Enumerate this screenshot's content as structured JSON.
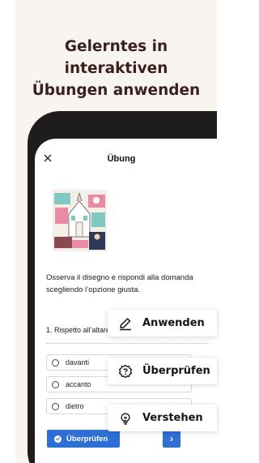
{
  "headline": {
    "line1": "Gelerntes in interaktiven",
    "line2": "Übungen anwenden"
  },
  "screen": {
    "title": "Übung",
    "prompt": "Osserva il disegno e rispondi alla domanda scegliendo l’opzione giusta.",
    "question": "1. Rispetto all’altare",
    "options": [
      "davanti",
      "accanto",
      "dietro"
    ],
    "check_label": "Überprüfen",
    "next_label": "›"
  },
  "chips": [
    {
      "label": "Anwenden",
      "icon": "pencil-icon"
    },
    {
      "label": "Überprüfen",
      "icon": "question-badge-icon"
    },
    {
      "label": "Verstehen",
      "icon": "lightbulb-icon"
    }
  ],
  "colors": {
    "headline": "#3a1f1e",
    "background": "#f8f5f0",
    "accent": "#2e6fd6",
    "phone": "#1e1d1c"
  }
}
